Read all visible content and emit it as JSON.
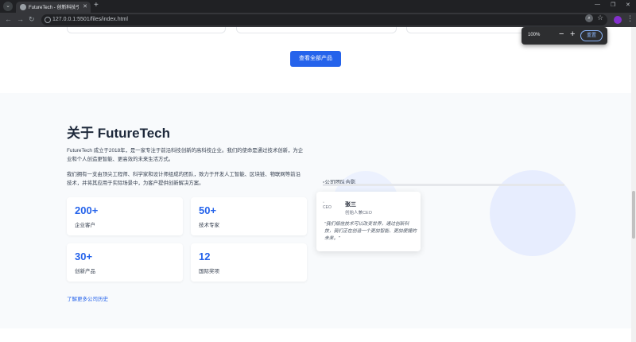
{
  "browser": {
    "tab_title": "FutureTech - 创新科技引领未来",
    "url": "127.0.0.1:5501/files/index.html",
    "new_tab": "+",
    "zoom_percent": "100%",
    "zoom_minus": "−",
    "zoom_plus": "+",
    "zoom_reset": "重置"
  },
  "products": {
    "view_all_label": "查看全部产品"
  },
  "about": {
    "title": "关于 FutureTech",
    "paragraph1": "FutureTech 成立于2018年，是一家专注于前沿科技创新的高科技企业。我们的使命是通过技术创新，为企业和个人创造更智能、更高效的未来生活方式。",
    "paragraph2": "我们拥有一支由顶尖工程师、科学家和设计师组成的团队，致力于开发人工智能、区块链、物联网等前沿技术，并将其应用于实际场景中，为客户提供创新解决方案。",
    "stats": [
      {
        "num": "200+",
        "label": "企业客户"
      },
      {
        "num": "50+",
        "label": "技术专家"
      },
      {
        "num": "30+",
        "label": "创新产品"
      },
      {
        "num": "12",
        "label": "国际奖项"
      }
    ],
    "history_link": "了解更多公司历史",
    "team_photo_alt": "公司团队合影",
    "quote": {
      "avatar_alt": "CEO",
      "name": "张三",
      "role": "创始人兼CEO",
      "text": "\"我们相信技术可以改变世界，通过创新科技，我们正在创造一个更加智能、更加便捷的未来。\""
    }
  }
}
